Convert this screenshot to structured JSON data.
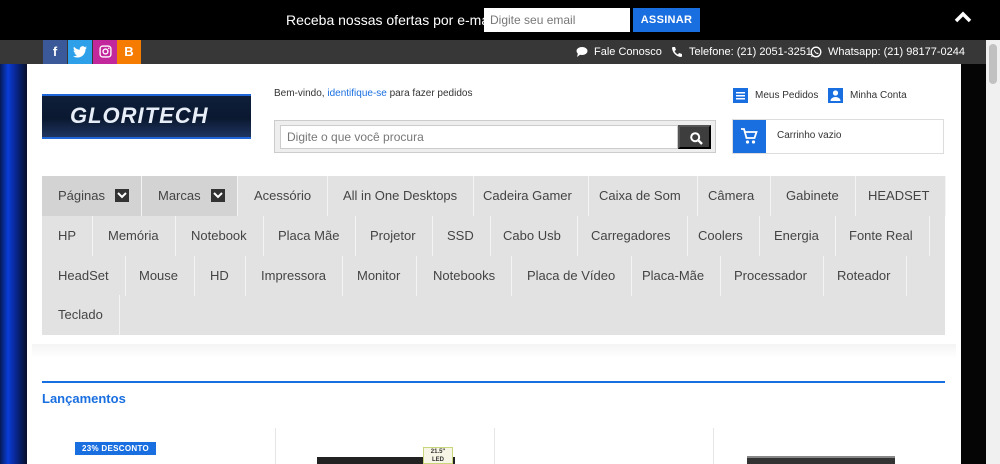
{
  "newsletter": {
    "label": "Receba nossas ofertas por e-mail",
    "placeholder": "Digite seu email",
    "submit_label": "ASSINAR"
  },
  "social": {
    "facebook": "f",
    "twitter": "t",
    "instagram": "o",
    "blog": "B"
  },
  "contact": {
    "fale_conosco": "Fale Conosco",
    "telefone": "Telefone: (21) 2051-3251",
    "whatsapp": "Whatsapp: (21) 98177-0244"
  },
  "header": {
    "logo_text": "GLORITECH",
    "welcome_prefix": "Bem-vindo, ",
    "welcome_link": "identifique-se",
    "welcome_suffix": " para fazer pedidos",
    "search_placeholder": "Digite o que você procura",
    "my_orders": "Meus Pedidos",
    "my_account": "Minha Conta",
    "cart_text": "Carrinho vazio"
  },
  "menu": {
    "items": [
      "Páginas",
      "Marcas",
      "Acessório",
      "All in One Desktops",
      "Cadeira Gamer",
      "Caixa de Som",
      "Câmera",
      "Gabinete",
      "HEADSET",
      "HP",
      "Memória",
      "Notebook",
      "Placa Mãe",
      "Projetor",
      "SSD",
      "Cabo Usb",
      "Carregadores",
      "Coolers",
      "Energia",
      "Fonte Real",
      "HeadSet",
      "Mouse",
      "HD",
      "Impressora",
      "Monitor",
      "Notebooks",
      "Placa de Vídeo",
      "Placa-Mãe",
      "Processador",
      "Roteador",
      "Teclado"
    ]
  },
  "section": {
    "title": "Lançamentos",
    "discount_badge": "23% DESCONTO",
    "product_tag": "21.5\" LED"
  },
  "colors": {
    "accent": "#1a6fe0",
    "topbar": "#000000",
    "infobar": "#373737",
    "menu_bg": "#e2e2e2"
  }
}
